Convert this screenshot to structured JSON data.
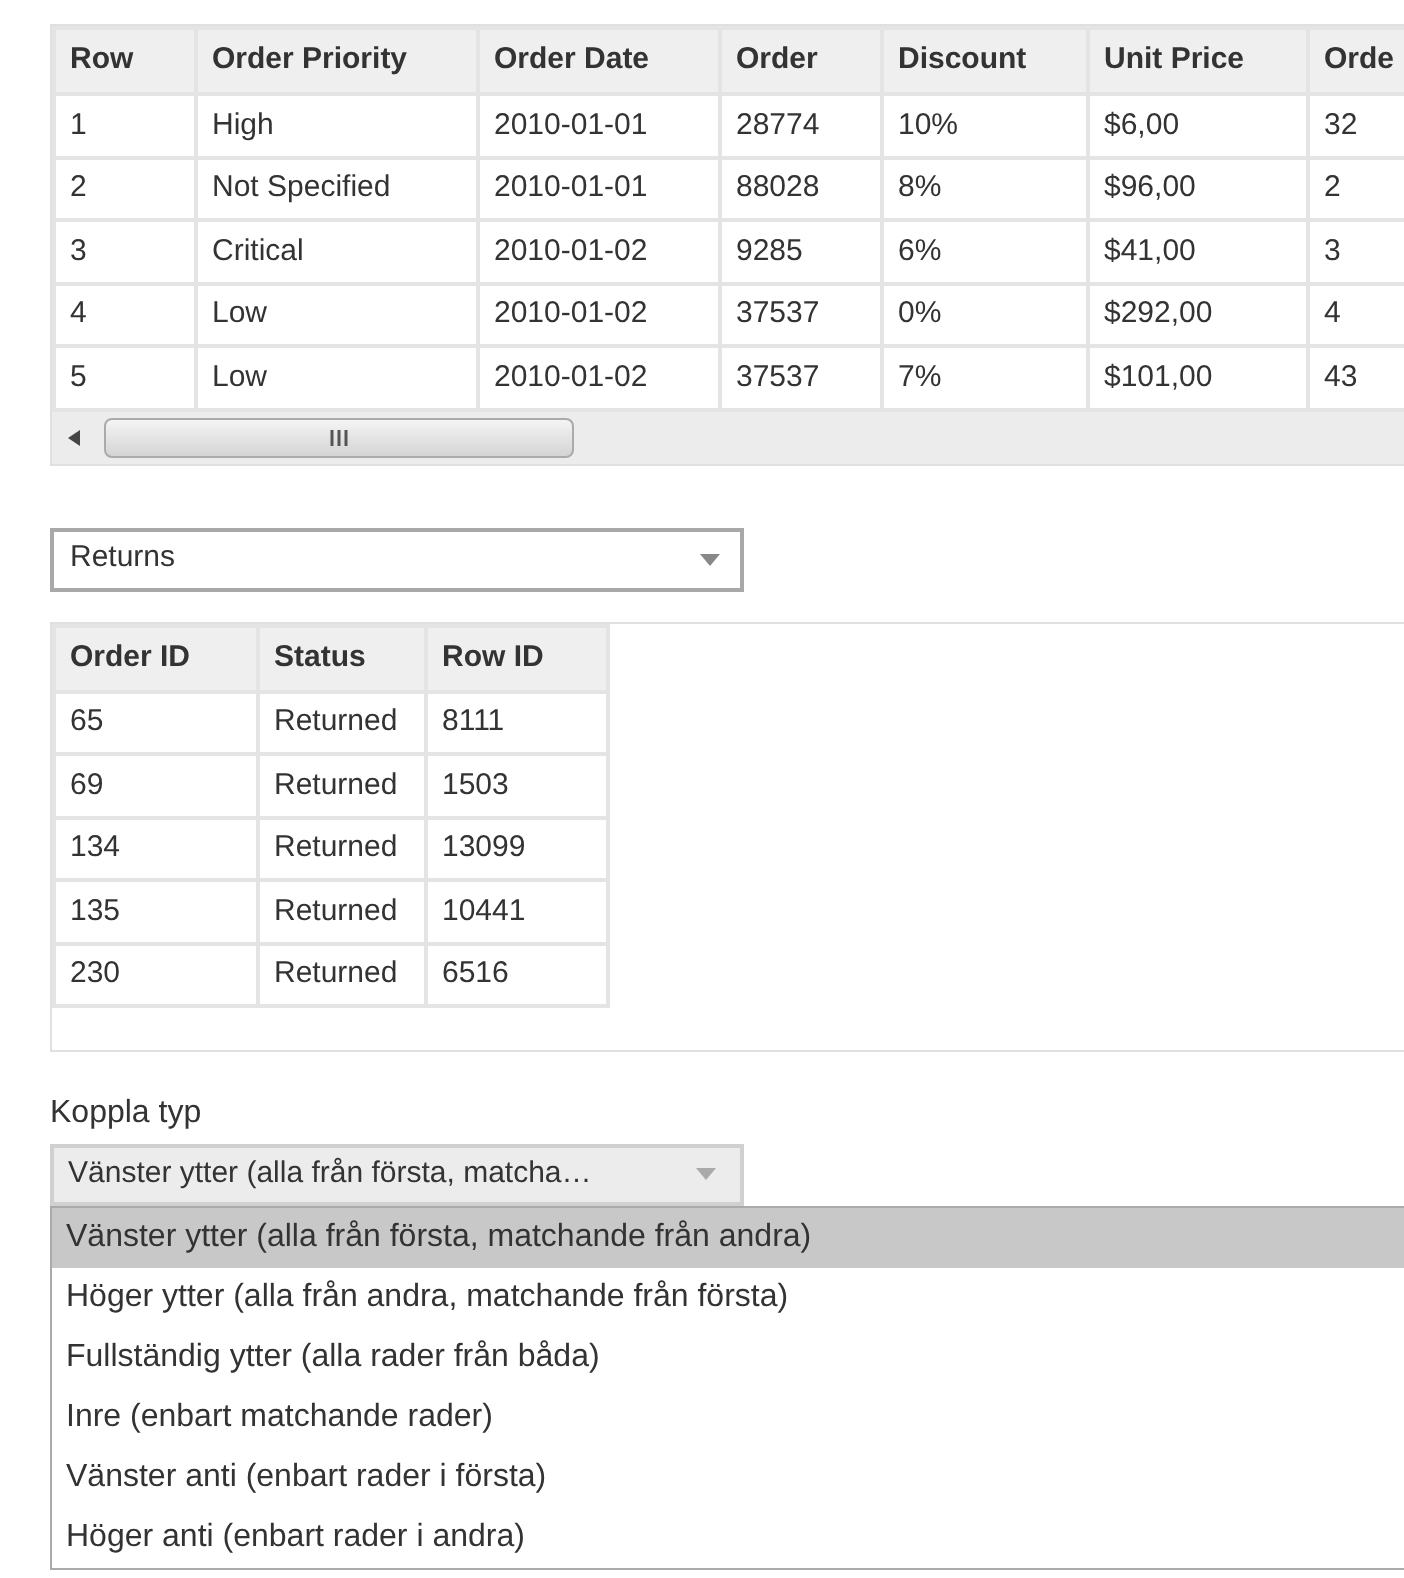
{
  "orders_table": {
    "columns": [
      "Row",
      "Order Priority",
      "Order Date",
      "Order",
      "Discount",
      "Unit Price",
      "Orde"
    ],
    "rows": [
      [
        "1",
        "High",
        "2010-01-01",
        "28774",
        "10%",
        "$6,00",
        "32"
      ],
      [
        "2",
        "Not Specified",
        "2010-01-01",
        "88028",
        "8%",
        "$96,00",
        "2"
      ],
      [
        "3",
        "Critical",
        "2010-01-02",
        "9285",
        "6%",
        "$41,00",
        "3"
      ],
      [
        "4",
        "Low",
        "2010-01-02",
        "37537",
        "0%",
        "$292,00",
        "4"
      ],
      [
        "5",
        "Low",
        "2010-01-02",
        "37537",
        "7%",
        "$101,00",
        "43"
      ]
    ]
  },
  "table_select": {
    "value": "Returns"
  },
  "returns_table": {
    "columns": [
      "Order ID",
      "Status",
      "Row ID"
    ],
    "rows": [
      [
        "65",
        "Returned",
        "8111"
      ],
      [
        "69",
        "Returned",
        "1503"
      ],
      [
        "134",
        "Returned",
        "13099"
      ],
      [
        "135",
        "Returned",
        "10441"
      ],
      [
        "230",
        "Returned",
        "6516"
      ]
    ]
  },
  "join_type": {
    "label": "Koppla typ",
    "value": "Vänster ytter (alla från första, matcha…",
    "options": [
      {
        "label": "Vänster ytter (alla från första, matchande från andra)",
        "selected": true
      },
      {
        "label": "Höger ytter (alla från andra, matchande från första)",
        "selected": false
      },
      {
        "label": "Fullständig ytter (alla rader från båda)",
        "selected": false
      },
      {
        "label": "Inre (enbart matchande rader)",
        "selected": false
      },
      {
        "label": "Vänster anti (enbart rader i första)",
        "selected": false
      },
      {
        "label": "Höger anti (enbart rader i andra)",
        "selected": false
      }
    ]
  }
}
